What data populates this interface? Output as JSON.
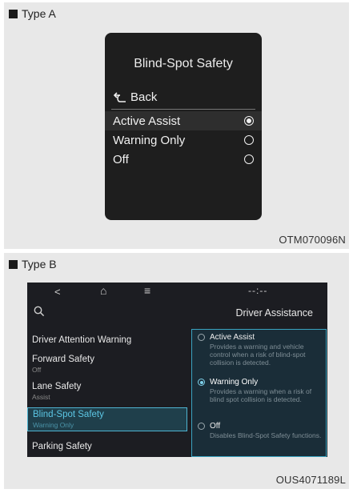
{
  "typeA": {
    "section_label": "Type A",
    "screen": {
      "title": "Blind-Spot Safety",
      "back_label": "Back",
      "options": [
        {
          "label": "Active Assist",
          "selected": true
        },
        {
          "label": "Warning Only",
          "selected": false
        },
        {
          "label": "Off",
          "selected": false
        }
      ]
    },
    "code": "OTM070096N"
  },
  "typeB": {
    "section_label": "Type B",
    "topbar": {
      "back_icon": "<",
      "home_icon": "⌂",
      "menu_icon": "≡",
      "clock": "--:--"
    },
    "header_title": "Driver Assistance",
    "menu": [
      {
        "label": "Driver Attention Warning",
        "sub": ""
      },
      {
        "label": "Forward Safety",
        "sub": "Off"
      },
      {
        "label": "Lane Safety",
        "sub": "Assist"
      },
      {
        "label": "Blind-Spot Safety",
        "sub": "Warning Only",
        "active": true
      },
      {
        "label": "Parking Safety",
        "sub": ""
      }
    ],
    "options": [
      {
        "label": "Active Assist",
        "desc": "Provides a warning and vehicle control when a risk of blind-spot collision is detected.",
        "selected": false
      },
      {
        "label": "Warning Only",
        "desc": "Provides a warning when a risk of blind spot collision is detected.",
        "selected": true
      },
      {
        "label": "Off",
        "desc": "Disables Blind-Spot Safety functions.",
        "selected": false
      }
    ],
    "code": "OUS4071189L"
  },
  "colors": {
    "accent": "#4fb4d1",
    "screen_dark": "#1e1e1e",
    "panel_bg": "#e8e8e8"
  }
}
